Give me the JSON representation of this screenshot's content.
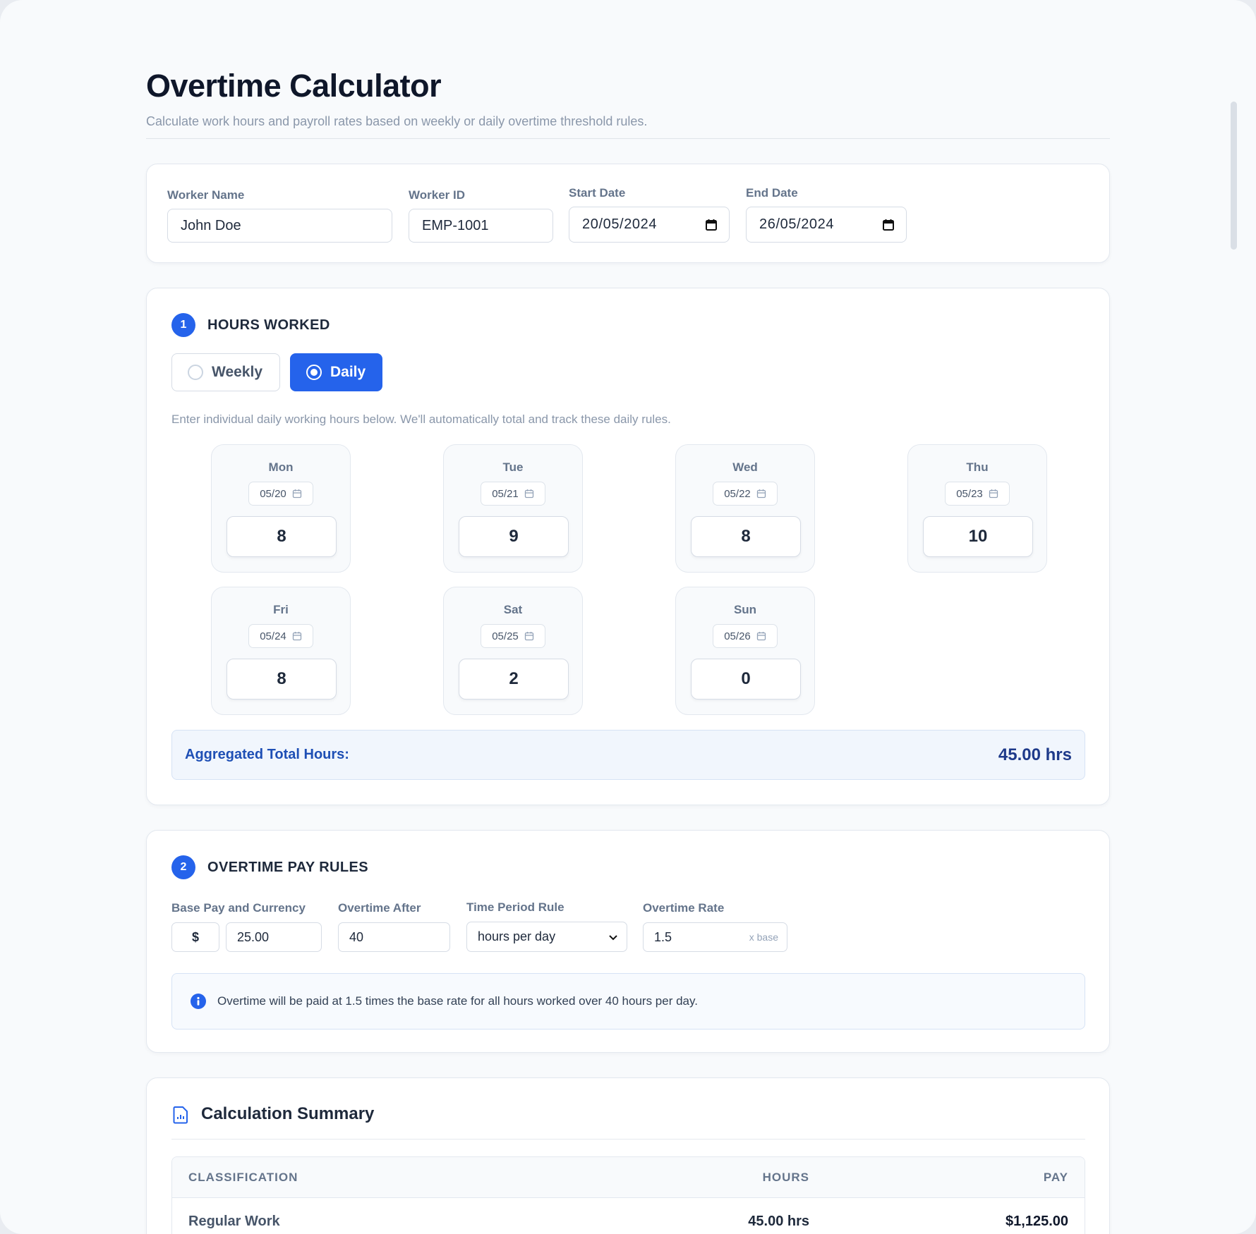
{
  "header": {
    "title": "Overtime Calculator",
    "subtitle": "Calculate work hours and payroll rates based on weekly or daily overtime threshold rules."
  },
  "worker": {
    "name_label": "Worker Name",
    "name_value": "John Doe",
    "id_label": "Worker ID",
    "id_value": "EMP-1001",
    "start_label": "Start Date",
    "start_value": "20/05/2024",
    "end_label": "End Date",
    "end_value": "26/05/2024"
  },
  "hours_section": {
    "number": "1",
    "title": "HOURS WORKED",
    "mode_weekly": "Weekly",
    "mode_daily": "Daily",
    "selected_mode": "Daily",
    "hint": "Enter individual daily working hours below. We'll automatically total and track these daily rules.",
    "days": [
      {
        "name": "Mon",
        "date": "05/20",
        "hours": "8"
      },
      {
        "name": "Tue",
        "date": "05/21",
        "hours": "9"
      },
      {
        "name": "Wed",
        "date": "05/22",
        "hours": "8"
      },
      {
        "name": "Thu",
        "date": "05/23",
        "hours": "10"
      },
      {
        "name": "Fri",
        "date": "05/24",
        "hours": "8"
      },
      {
        "name": "Sat",
        "date": "05/25",
        "hours": "2"
      },
      {
        "name": "Sun",
        "date": "05/26",
        "hours": "0"
      }
    ],
    "total_label": "Aggregated Total Hours:",
    "total_value": "45.00 hrs"
  },
  "rules_section": {
    "number": "2",
    "title": "OVERTIME PAY RULES",
    "base_label": "Base Pay and Currency",
    "currency": "$",
    "base_value": "25.00",
    "after_label": "Overtime After",
    "after_value": "40",
    "period_label": "Time Period Rule",
    "period_value": "hours per day",
    "rate_label": "Overtime Rate",
    "rate_value": "1.5",
    "rate_suffix": "x base",
    "info_text": "Overtime will be paid at 1.5 times the base rate for all hours worked over 40 hours per day."
  },
  "summary": {
    "title": "Calculation Summary",
    "columns": [
      "CLASSIFICATION",
      "HOURS",
      "PAY"
    ],
    "rows": [
      {
        "classification": "Regular Work",
        "hours": "45.00 hrs",
        "pay": "$1,125.00"
      }
    ]
  },
  "colors": {
    "accent": "#2563eb",
    "background": "#f8fafc",
    "total_text": "#1e3a8a"
  }
}
